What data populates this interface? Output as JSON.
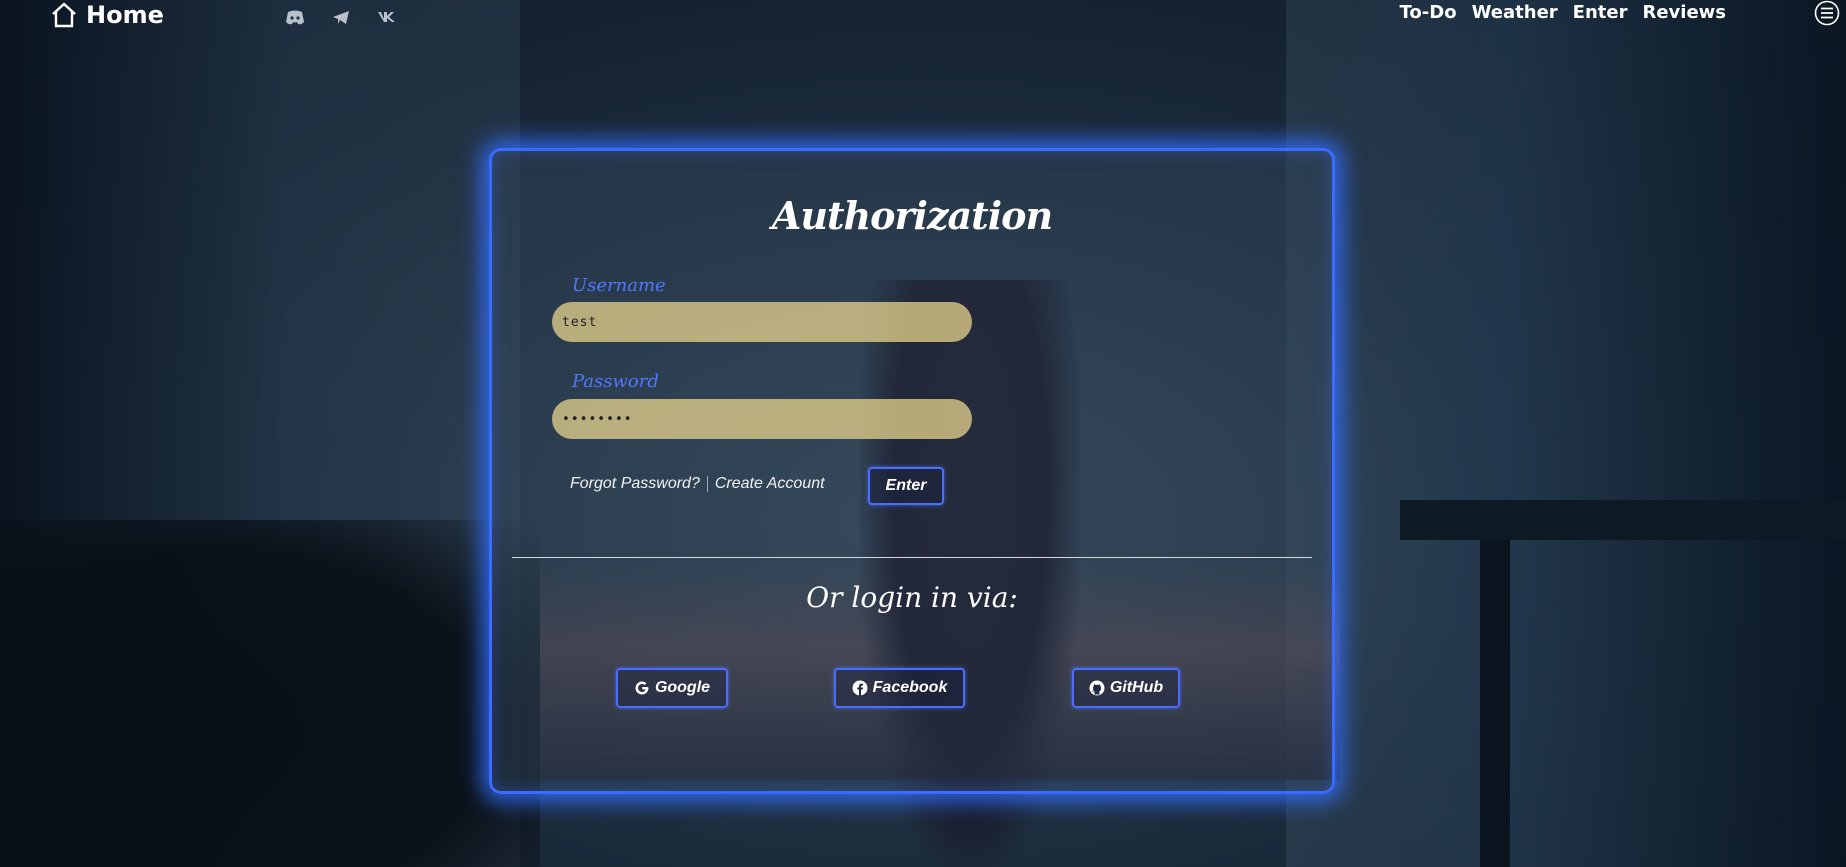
{
  "nav": {
    "home_label": "Home",
    "socials": [
      "discord-icon",
      "telegram-icon",
      "vk-icon"
    ],
    "links": [
      "To-Do",
      "Weather",
      "Enter",
      "Reviews"
    ]
  },
  "form": {
    "title": "Authorization",
    "username_label": "Username",
    "username_value": "test",
    "password_label": "Password",
    "password_value": "••••••••",
    "forgot_label": "Forgot Password?",
    "create_label": "Create Account",
    "enter_label": "Enter",
    "alt_title": "Or login in via:",
    "providers": [
      "Google",
      "Facebook",
      "GitHub"
    ]
  },
  "colors": {
    "accent": "#3b6cff",
    "field_bg": "#e8d48c",
    "label": "#4f78ff"
  }
}
